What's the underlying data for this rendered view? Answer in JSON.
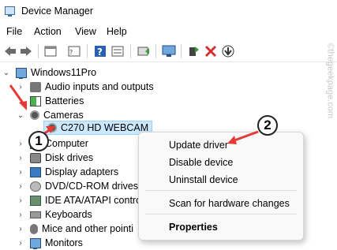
{
  "window": {
    "title": "Device Manager"
  },
  "menu": [
    "File",
    "Action",
    "View",
    "Help"
  ],
  "toolbar": [
    "back-icon",
    "forward-icon",
    "properties-icon",
    "show-hidden-icon",
    "help-icon",
    "details-icon",
    "update-driver-icon",
    "scan-hardware-icon",
    "add-driver-icon",
    "uninstall-icon",
    "download-icon"
  ],
  "tree": {
    "root": "Windows11Pro",
    "items": [
      {
        "label": "Audio inputs and outputs",
        "icon": "speaker-icon",
        "expanded": false
      },
      {
        "label": "Batteries",
        "icon": "battery-icon",
        "expanded": false
      },
      {
        "label": "Cameras",
        "icon": "camera-icon",
        "expanded": true
      },
      {
        "label": "C270 HD WEBCAM",
        "icon": "webcam-icon",
        "child": true,
        "selected": true
      },
      {
        "label": "Computer",
        "icon": "computer-icon",
        "expanded": false
      },
      {
        "label": "Disk drives",
        "icon": "disk-icon",
        "expanded": false
      },
      {
        "label": "Display adapters",
        "icon": "display-icon",
        "expanded": false
      },
      {
        "label": "DVD/CD-ROM drives",
        "icon": "dvd-icon",
        "expanded": false
      },
      {
        "label": "IDE ATA/ATAPI contro",
        "icon": "ide-icon",
        "expanded": false
      },
      {
        "label": "Keyboards",
        "icon": "keyboard-icon",
        "expanded": false
      },
      {
        "label": "Mice and other pointi",
        "icon": "mouse-icon",
        "expanded": false
      },
      {
        "label": "Monitors",
        "icon": "monitor-icon",
        "expanded": false
      }
    ]
  },
  "context_menu": {
    "update": "Update driver",
    "disable": "Disable device",
    "uninstall": "Uninstall device",
    "scan": "Scan for hardware changes",
    "properties": "Properties"
  },
  "annotations": {
    "step1": "1",
    "step2": "2"
  },
  "watermark": "©thegeekpage.com",
  "colors": {
    "arrow": "#e53935",
    "selection": "#cce8ff",
    "red_x": "#d32f2f"
  }
}
